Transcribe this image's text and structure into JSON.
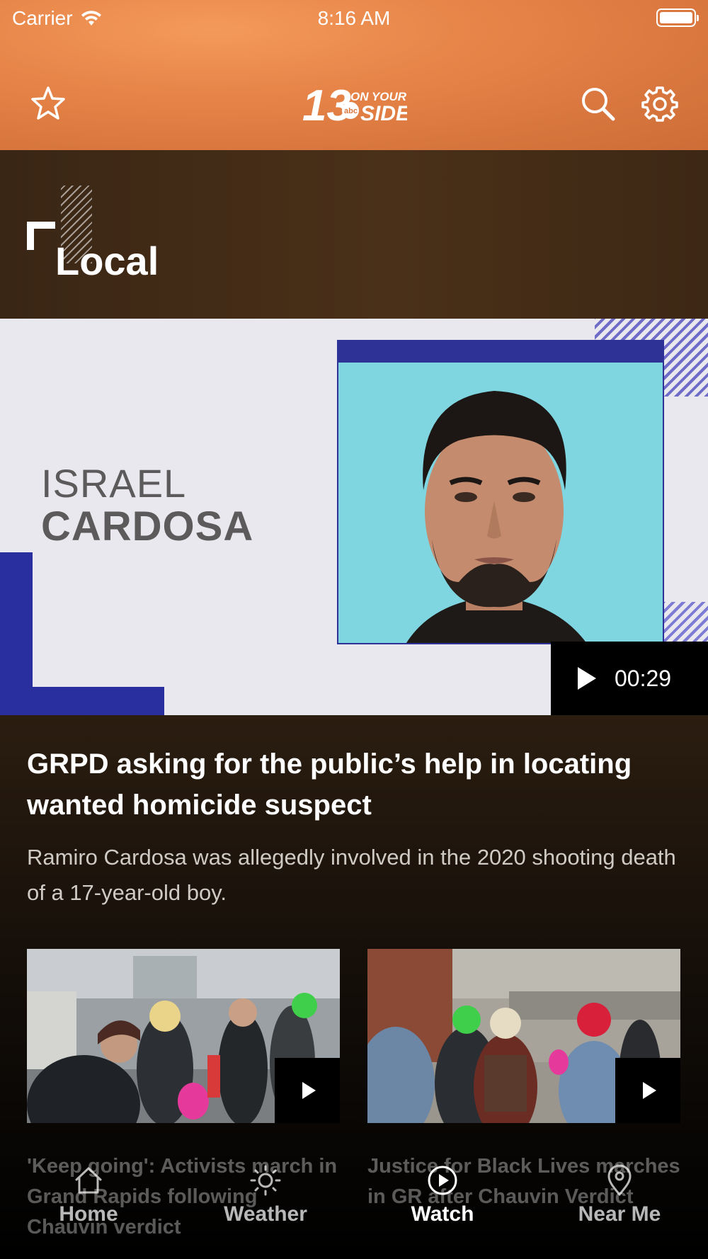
{
  "status_bar": {
    "carrier": "Carrier",
    "time": "8:16 AM"
  },
  "header": {
    "logo_alt": "13 ON YOUR SIDE abc",
    "favorite_icon": "star-icon",
    "search_icon": "search-icon",
    "settings_icon": "gear-icon"
  },
  "section": {
    "title": "Local"
  },
  "hero": {
    "graphic_first_name": "ISRAEL",
    "graphic_last_name": "CARDOSA",
    "duration": "00:29",
    "title": "GRPD asking for the public’s help in locating wanted homicide suspect",
    "summary": "Ramiro Cardosa was allegedly involved in the 2020 shooting death of a 17-year-old boy."
  },
  "cards": [
    {
      "title": "'Keep going': Activists march in Grand Rapids following Chauvin verdict"
    },
    {
      "title": "Justice for Black Lives marches in GR after Chauvin Verdict"
    }
  ],
  "tabbar": {
    "tabs": [
      {
        "label": "Home",
        "icon": "home-icon"
      },
      {
        "label": "Weather",
        "icon": "sun-icon"
      },
      {
        "label": "Watch",
        "icon": "play-circle-icon",
        "active": true
      },
      {
        "label": "Near Me",
        "icon": "location-pin-icon"
      }
    ]
  },
  "colors": {
    "header_orange": "#e8864a",
    "hero_blue": "#2a2fa0",
    "photo_cyan": "#7fd6e0"
  }
}
